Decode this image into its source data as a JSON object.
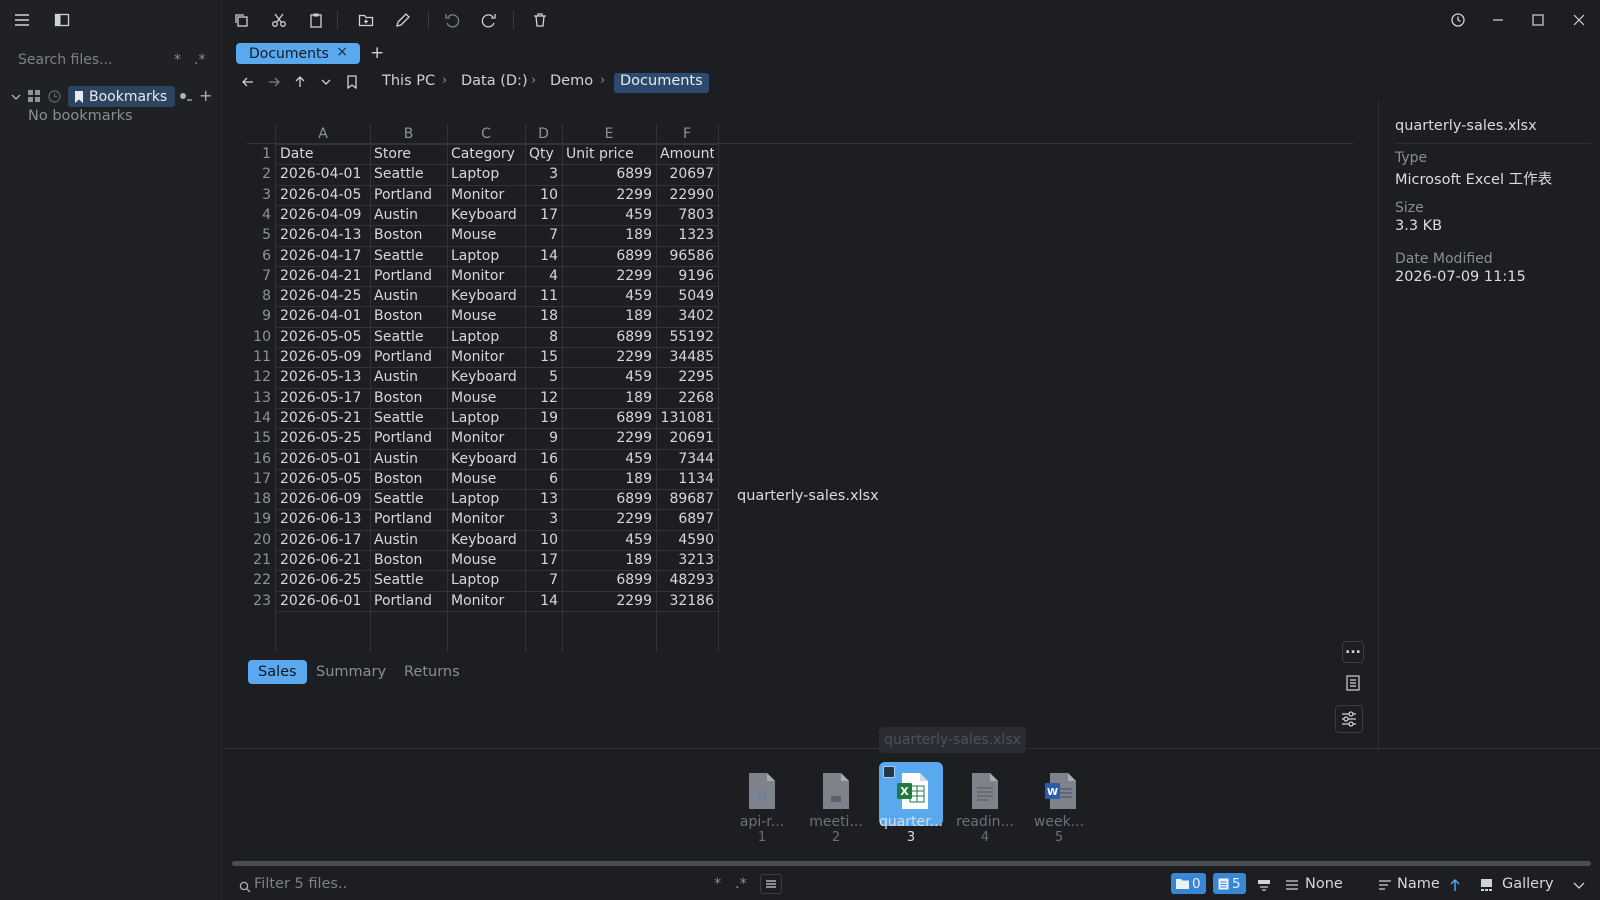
{
  "toolbar": {
    "icons": [
      "menu-icon",
      "sidebar-toggle-icon",
      "copy-icon",
      "cut-icon",
      "paste-icon",
      "new-folder-icon",
      "rename-icon",
      "undo-icon",
      "redo-icon",
      "delete-icon",
      "history-icon",
      "minimize-icon",
      "maximize-icon",
      "close-icon"
    ]
  },
  "sidebar": {
    "search_placeholder": "Search files...",
    "search_opt1": "*",
    "search_opt2": ".*",
    "bookmarks_label": "Bookmarks",
    "no_bookmarks": "No bookmarks"
  },
  "tabs": [
    {
      "label": "Documents",
      "close": "×"
    }
  ],
  "new_tab": "+",
  "breadcrumb": [
    "This PC",
    "Data (D:)",
    "Demo",
    "Documents"
  ],
  "crumb_sep": "›",
  "sheet": {
    "col_letters": [
      "A",
      "B",
      "C",
      "D",
      "E",
      "F"
    ],
    "rows": [
      [
        "Date",
        "Store",
        "Category",
        "Qty",
        "Unit price",
        "Amount"
      ],
      [
        "2026-04-01",
        "Seattle",
        "Laptop",
        "3",
        "6899",
        "20697"
      ],
      [
        "2026-04-05",
        "Portland",
        "Monitor",
        "10",
        "2299",
        "22990"
      ],
      [
        "2026-04-09",
        "Austin",
        "Keyboard",
        "17",
        "459",
        "7803"
      ],
      [
        "2026-04-13",
        "Boston",
        "Mouse",
        "7",
        "189",
        "1323"
      ],
      [
        "2026-04-17",
        "Seattle",
        "Laptop",
        "14",
        "6899",
        "96586"
      ],
      [
        "2026-04-21",
        "Portland",
        "Monitor",
        "4",
        "2299",
        "9196"
      ],
      [
        "2026-04-25",
        "Austin",
        "Keyboard",
        "11",
        "459",
        "5049"
      ],
      [
        "2026-04-01",
        "Boston",
        "Mouse",
        "18",
        "189",
        "3402"
      ],
      [
        "2026-05-05",
        "Seattle",
        "Laptop",
        "8",
        "6899",
        "55192"
      ],
      [
        "2026-05-09",
        "Portland",
        "Monitor",
        "15",
        "2299",
        "34485"
      ],
      [
        "2026-05-13",
        "Austin",
        "Keyboard",
        "5",
        "459",
        "2295"
      ],
      [
        "2026-05-17",
        "Boston",
        "Mouse",
        "12",
        "189",
        "2268"
      ],
      [
        "2026-05-21",
        "Seattle",
        "Laptop",
        "19",
        "6899",
        "131081"
      ],
      [
        "2026-05-25",
        "Portland",
        "Monitor",
        "9",
        "2299",
        "20691"
      ],
      [
        "2026-05-01",
        "Austin",
        "Keyboard",
        "16",
        "459",
        "7344"
      ],
      [
        "2026-05-05",
        "Boston",
        "Mouse",
        "6",
        "189",
        "1134"
      ],
      [
        "2026-06-09",
        "Seattle",
        "Laptop",
        "13",
        "6899",
        "89687"
      ],
      [
        "2026-06-13",
        "Portland",
        "Monitor",
        "3",
        "2299",
        "6897"
      ],
      [
        "2026-06-17",
        "Austin",
        "Keyboard",
        "10",
        "459",
        "4590"
      ],
      [
        "2026-06-21",
        "Boston",
        "Mouse",
        "17",
        "189",
        "3213"
      ],
      [
        "2026-06-25",
        "Seattle",
        "Laptop",
        "7",
        "6899",
        "48293"
      ],
      [
        "2026-06-01",
        "Portland",
        "Monitor",
        "14",
        "2299",
        "32186"
      ]
    ],
    "sheet_tabs": [
      "Sales",
      "Summary",
      "Returns"
    ],
    "active_sheet": "Sales",
    "center_filename": "quarterly-sales.xlsx"
  },
  "details": {
    "filename": "quarterly-sales.xlsx",
    "type_label": "Type",
    "type_value": "Microsoft Excel 工作表",
    "size_label": "Size",
    "size_value": "3.3 KB",
    "modified_label": "Date Modified",
    "modified_value": "2026-07-09 11:15"
  },
  "preview_buttons": {
    "more": "..."
  },
  "gallery": {
    "tooltip": "quarterly-sales.xlsx",
    "items": [
      {
        "name": "api-r...",
        "index": "1",
        "icon": "json-file-icon"
      },
      {
        "name": "meeti...",
        "index": "2",
        "icon": "document-file-icon"
      },
      {
        "name": "quarter...",
        "index": "3",
        "icon": "excel-file-icon",
        "selected": true
      },
      {
        "name": "readin...",
        "index": "4",
        "icon": "text-file-icon"
      },
      {
        "name": "week...",
        "index": "5",
        "icon": "word-file-icon"
      }
    ]
  },
  "statusbar": {
    "filter_placeholder": "Filter 5 files..",
    "filter_opt1": "*",
    "filter_opt2": ".*",
    "folder_count": "0",
    "file_count": "5",
    "group_by": "None",
    "sort_by": "Name",
    "view_mode": "Gallery"
  },
  "colors": {
    "accent": "#5aa9ee",
    "background": "#1c1e22",
    "excel_green": "#1f7a44",
    "word_blue": "#2b5cab"
  }
}
